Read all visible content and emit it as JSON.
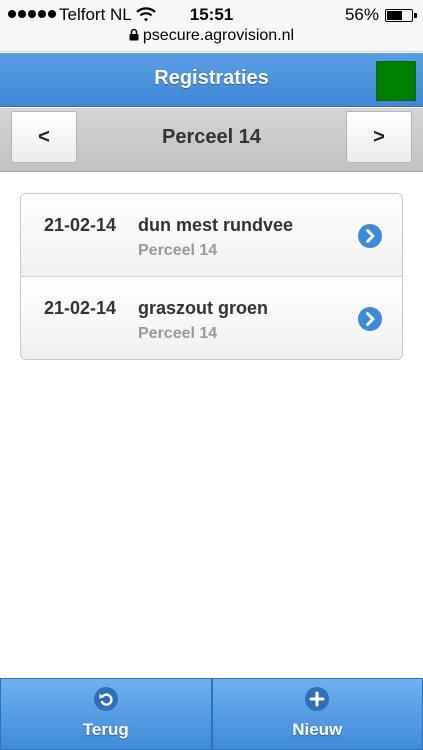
{
  "status_bar": {
    "carrier": "Telfort NL",
    "time": "15:51",
    "battery_percent": "56%",
    "battery_level": 0.56,
    "url": "psecure.agrovision.nl"
  },
  "header": {
    "title": "Registraties",
    "status_color": "#008000"
  },
  "nav": {
    "prev_label": "<",
    "next_label": ">",
    "title": "Perceel 14"
  },
  "list": {
    "items": [
      {
        "date": "21-02-14",
        "title": "dun mest rundvee",
        "subtitle": "Perceel 14"
      },
      {
        "date": "21-02-14",
        "title": "graszout groen",
        "subtitle": "Perceel 14"
      }
    ]
  },
  "footer": {
    "back_label": "Terug",
    "new_label": "Nieuw"
  },
  "colors": {
    "accent": "#3f87d6",
    "arrow_icon": "#3d8ad8"
  }
}
